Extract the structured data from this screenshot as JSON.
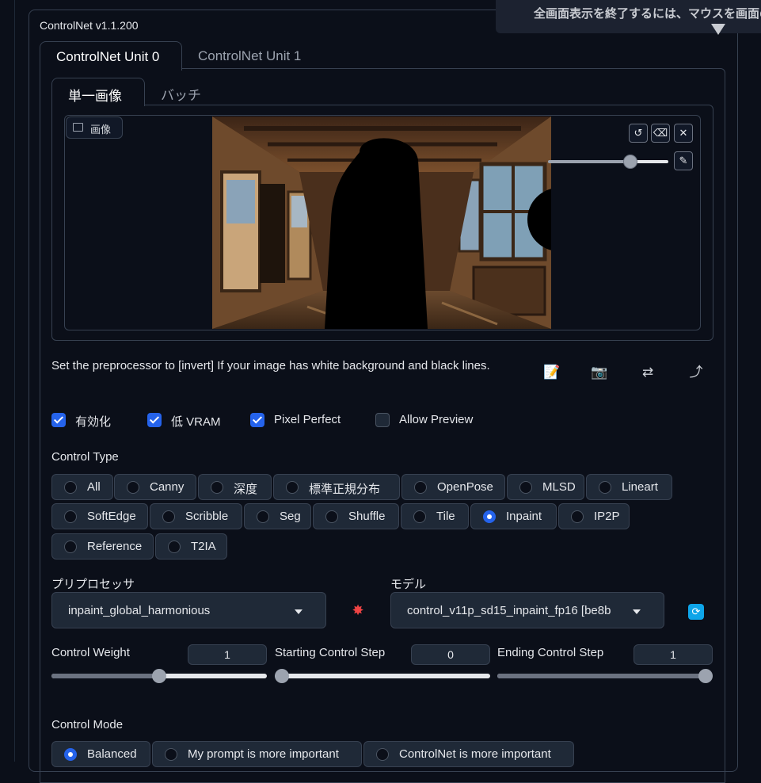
{
  "fullscreen_notice": {
    "text": "全画面表示を終了するには、マウスを画面の"
  },
  "controlnet": {
    "title": "ControlNet v1.1.200",
    "unit_tabs": [
      {
        "label": "ControlNet Unit 0"
      },
      {
        "label": "ControlNet Unit 1"
      }
    ],
    "image_tabs": [
      {
        "label": "単一画像"
      },
      {
        "label": "バッチ"
      }
    ],
    "image_label": "画像",
    "hint": "Set the preprocessor to [invert] If your image has white background and black lines.",
    "checkboxes": [
      {
        "label": "有効化",
        "checked": true
      },
      {
        "label": "低 VRAM",
        "checked": true
      },
      {
        "label": "Pixel Perfect",
        "checked": true
      },
      {
        "label": "Allow Preview",
        "checked": false
      }
    ],
    "control_type": {
      "label": "Control Type",
      "selected": "Inpaint",
      "options": [
        "All",
        "Canny",
        "深度",
        "標準正規分布",
        "OpenPose",
        "MLSD",
        "Lineart",
        "SoftEdge",
        "Scribble",
        "Seg",
        "Shuffle",
        "Tile",
        "Inpaint",
        "IP2P",
        "Reference",
        "T2IA"
      ]
    },
    "preprocessor": {
      "label": "プリプロセッサ",
      "value": "inpaint_global_harmonious"
    },
    "model": {
      "label": "モデル",
      "value": "control_v11p_sd15_inpaint_fp16 [be8b"
    },
    "sliders": [
      {
        "label": "Control Weight",
        "value": "1",
        "fraction": 0.5
      },
      {
        "label": "Starting Control Step",
        "value": "0",
        "fraction": 0.0
      },
      {
        "label": "Ending Control Step",
        "value": "1",
        "fraction": 1.0
      }
    ],
    "control_mode": {
      "label": "Control Mode",
      "selected": "Balanced",
      "options": [
        "Balanced",
        "My prompt is more important",
        "ControlNet is more important"
      ]
    },
    "colors": {
      "accent": "#2563eb",
      "panel_bg": "#0b0f19",
      "button_bg": "#1f2937",
      "border": "#374151"
    }
  }
}
